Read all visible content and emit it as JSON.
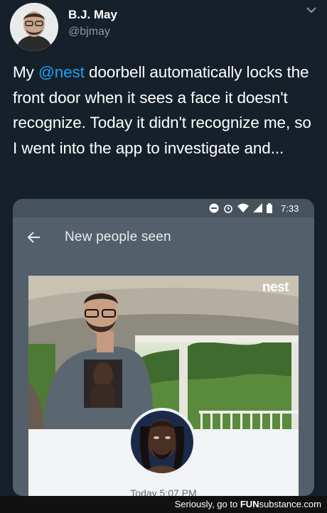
{
  "tweet": {
    "display_name": "B.J. May",
    "handle": "@bjmay",
    "text_before": "My ",
    "mention": "@nest",
    "text_after": " doorbell automatically locks the front door when it sees a face it doesn't recognize. Today it didn't recognize me, so I went into the app to investigate and...",
    "menu_icon": "chevron-down-icon",
    "link_color": "#1da1f2"
  },
  "phone": {
    "status_time": "7:33",
    "title": "New people seen",
    "back_icon": "arrow-left-icon",
    "brand": "nest",
    "timestamp": "Today 5:07 PM"
  },
  "watermark": {
    "prefix": "Seriously, go to ",
    "site_bold": "FUN",
    "site_rest": "substance.com"
  }
}
